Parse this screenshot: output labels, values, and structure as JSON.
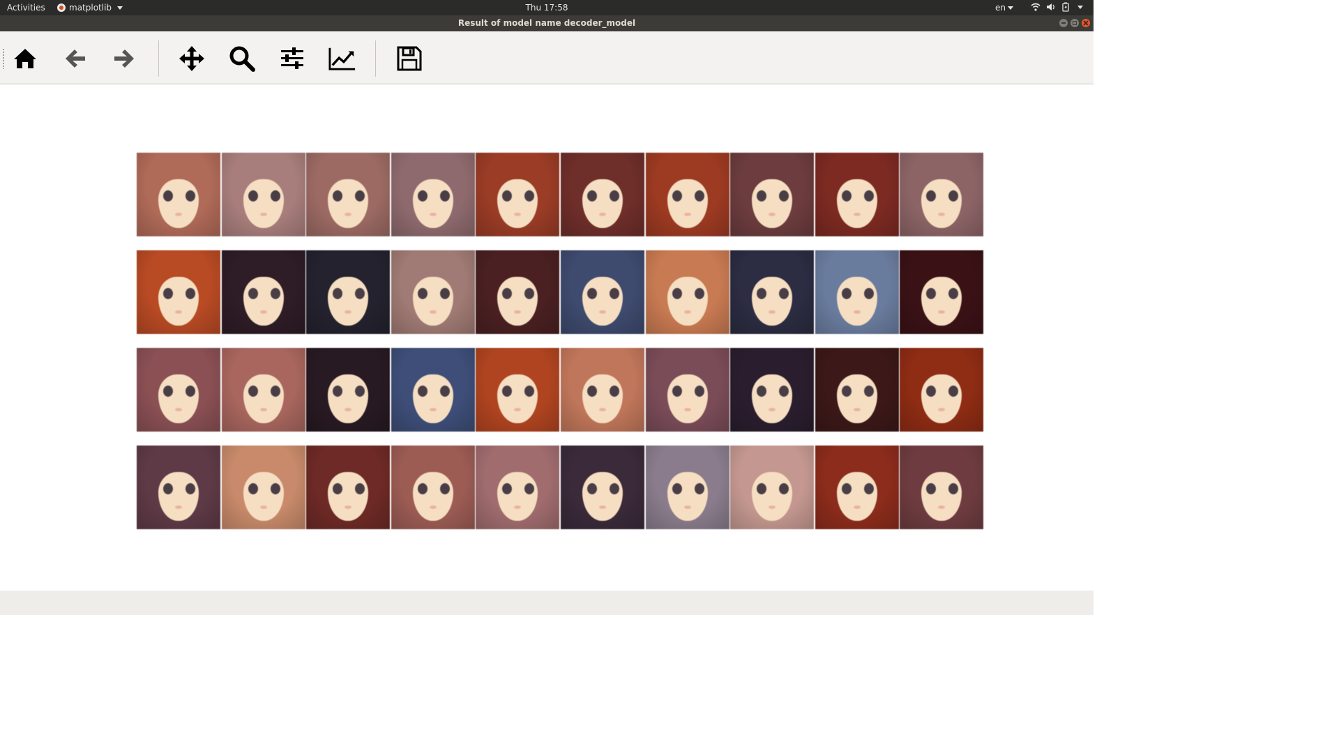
{
  "topbar": {
    "activities": "Activities",
    "app_name": "matplotlib",
    "clock": "Thu 17:58",
    "language": "en",
    "icons": [
      "wifi-icon",
      "volume-icon",
      "battery-icon",
      "system-menu-icon"
    ]
  },
  "window": {
    "title": "Result of model name decoder_model"
  },
  "toolbar": {
    "buttons": [
      "home-icon",
      "back-icon",
      "forward-icon",
      "pan-icon",
      "zoom-icon",
      "configure-subplots-icon",
      "edit-axes-icon",
      "save-icon"
    ]
  },
  "figure": {
    "rows": 4,
    "cols": 10,
    "hair_colors": [
      [
        "#b06a58",
        "#a87e7c",
        "#9c6a63",
        "#8e6a6e",
        "#9a3c26",
        "#6e2e2a",
        "#9d3a22",
        "#6c3c3e",
        "#7c2a22",
        "#8c6466"
      ],
      [
        "#b84a24",
        "#2e1c26",
        "#24222e",
        "#a07a74",
        "#4a2022",
        "#3e4a6e",
        "#c87a52",
        "#2c2c42",
        "#6a7c9e",
        "#3a1216"
      ],
      [
        "#8a5054",
        "#a8665e",
        "#281a22",
        "#3e4e78",
        "#b04420",
        "#c0765a",
        "#7a4c58",
        "#2a1e2e",
        "#3c1818",
        "#8e2c14"
      ],
      [
        "#5e3a46",
        "#c88a6a",
        "#6e2a26",
        "#9c5c54",
        "#a06c6e",
        "#3a2a3a",
        "#8a7c8c",
        "#c49890",
        "#8c2c1c",
        "#6e3c40"
      ]
    ]
  },
  "statusbar": {
    "message": ""
  }
}
